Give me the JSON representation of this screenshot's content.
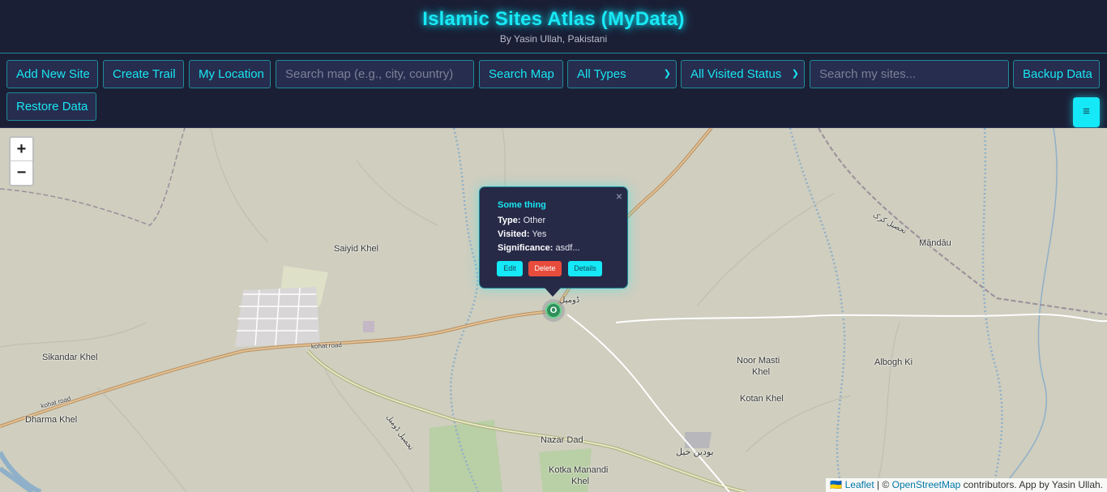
{
  "header": {
    "title": "Islamic Sites Atlas (MyData)",
    "subtitle": "By Yasin Ullah, Pakistani"
  },
  "toolbar": {
    "add_site": "Add New Site",
    "create_trail": "Create Trail",
    "my_location": "My Location",
    "search_map_placeholder": "Search map (e.g., city, country)",
    "search_map": "Search Map",
    "type_filter": "All Types",
    "visited_filter": "All Visited Status",
    "search_sites_placeholder": "Search my sites...",
    "backup": "Backup Data",
    "restore": "Restore Data",
    "menu_icon": "hamburger-icon",
    "menu_glyph": "≡"
  },
  "map": {
    "zoom_in": "+",
    "zoom_out": "−",
    "places": {
      "saiyid_khel": "Saiyid Khel",
      "mandau": "Māndāu",
      "sikandar_khel": "Sikandar Khel",
      "kohat_road_1": "kohat road",
      "kohat_road_2": "kohat road",
      "dharma_khel": "Dharma Khel",
      "noor_masti_1": "Noor Masti",
      "noor_masti_2": "Khel",
      "albogh_ki": "Albogh Ki",
      "kotan_khel": "Kotan Khel",
      "nazar_dad": "Nazar Dad",
      "kotka_1": "Kotka Manandi",
      "kotka_2": "Khel",
      "urdu_1": "تحصیل کرک",
      "urdu_2": "بودین خیل",
      "urdu_3": "تحصیل ڈومیل",
      "urdu_4": "ڈومیل"
    },
    "marker_label": "O"
  },
  "popup": {
    "close": "×",
    "title": "Some thing",
    "type_label": "Type:",
    "type_value": "Other",
    "visited_label": "Visited:",
    "visited_value": "Yes",
    "significance_label": "Significance:",
    "significance_value": "asdf...",
    "edit": "Edit",
    "delete": "Delete",
    "details": "Details"
  },
  "attribution": {
    "flag": "🇺🇦",
    "leaflet": "Leaflet",
    "sep": " | © ",
    "osm": "OpenStreetMap",
    "rest": " contributors. App by Yasin Ullah."
  },
  "colors": {
    "accent": "#19e6f2",
    "background": "#1b1f36",
    "delete": "#e74c3c",
    "marker": "#2f8f5d"
  }
}
